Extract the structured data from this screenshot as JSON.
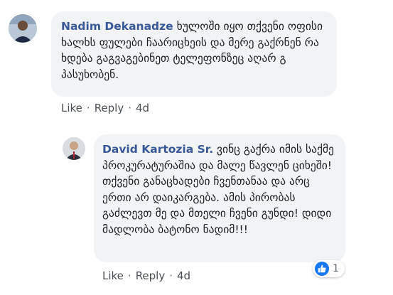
{
  "comments": [
    {
      "author": "Nadim Dekanadze",
      "text": "ხულოში იყო თქვენი ოფისი ხალხს ფულები ჩაარიცხეის და მერე გაქრნენ რა ხდება გაგვაგებინეთ ტელეფონზეც აღარ გ პასუხობენ.",
      "like_label": "Like",
      "reply_label": "Reply",
      "time": "4d"
    },
    {
      "author": "David Kartozia Sr.",
      "text": "ვინც გაქრა იმის საქმე პროკურატურაშია და მალე წავლენ ციხეში! თქვენი განაცხადები ჩვენთანაა და არც ერთი არ დაიკარგება. ამის პირობას გაძლევთ მე და მთელი ჩვენი გუნდი! დიდი მადლობა ბატონო ნადიმ!!!",
      "like_label": "Like",
      "reply_label": "Reply",
      "time": "4d",
      "reaction_count": "1"
    }
  ],
  "separator": "·",
  "colors": {
    "name": "#385898",
    "bubble": "#f2f3f5",
    "like_blue": "#1877f2"
  },
  "icons": {
    "reaction": "thumbs-up-icon"
  }
}
